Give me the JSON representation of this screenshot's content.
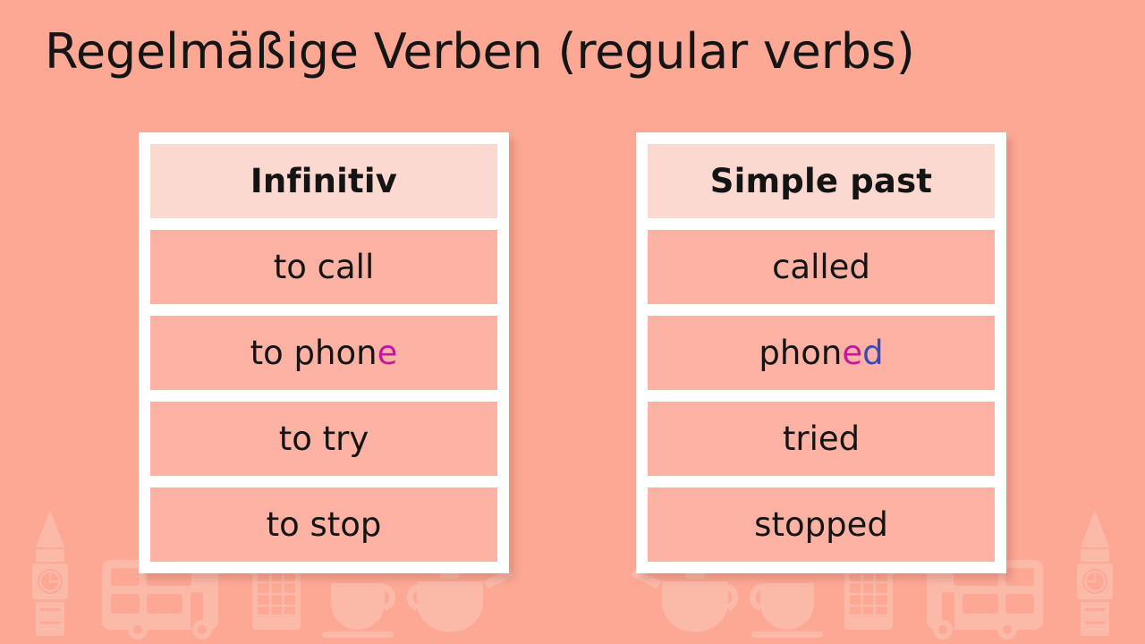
{
  "slide": {
    "title": "Regelmäßige Verben (regular verbs)",
    "background_color": "#FCA894",
    "accent_colors": {
      "header_cell": "#FBD9D1",
      "body_cell": "#FDB2A4",
      "table_frame": "#FFFFFF",
      "text": "#141414",
      "highlight_magenta": "#C2199B",
      "highlight_blue": "#3B47BE"
    }
  },
  "tables": [
    {
      "id": "infinitiv",
      "header": "Infinitiv",
      "rows": [
        {
          "segments": [
            {
              "text": "to call",
              "color": "#141414"
            }
          ]
        },
        {
          "segments": [
            {
              "text": "to phon",
              "color": "#141414"
            },
            {
              "text": "e",
              "color": "#C2199B"
            }
          ]
        },
        {
          "segments": [
            {
              "text": "to try",
              "color": "#141414"
            }
          ]
        },
        {
          "segments": [
            {
              "text": "to stop",
              "color": "#141414"
            }
          ]
        }
      ]
    },
    {
      "id": "simple-past",
      "header": "Simple past",
      "rows": [
        {
          "segments": [
            {
              "text": "called",
              "color": "#141414"
            }
          ]
        },
        {
          "segments": [
            {
              "text": "phon",
              "color": "#141414"
            },
            {
              "text": "e",
              "color": "#C2199B"
            },
            {
              "text": "d",
              "color": "#3B47BE"
            }
          ]
        },
        {
          "segments": [
            {
              "text": "tried",
              "color": "#141414"
            }
          ]
        },
        {
          "segments": [
            {
              "text": "stopped",
              "color": "#141414"
            }
          ]
        }
      ]
    }
  ],
  "decorations": {
    "color": "#FBB9A8",
    "icons": [
      "big-ben-icon",
      "double-decker-bus-icon",
      "telephone-box-icon",
      "teapot-icon",
      "teacup-icon"
    ]
  }
}
